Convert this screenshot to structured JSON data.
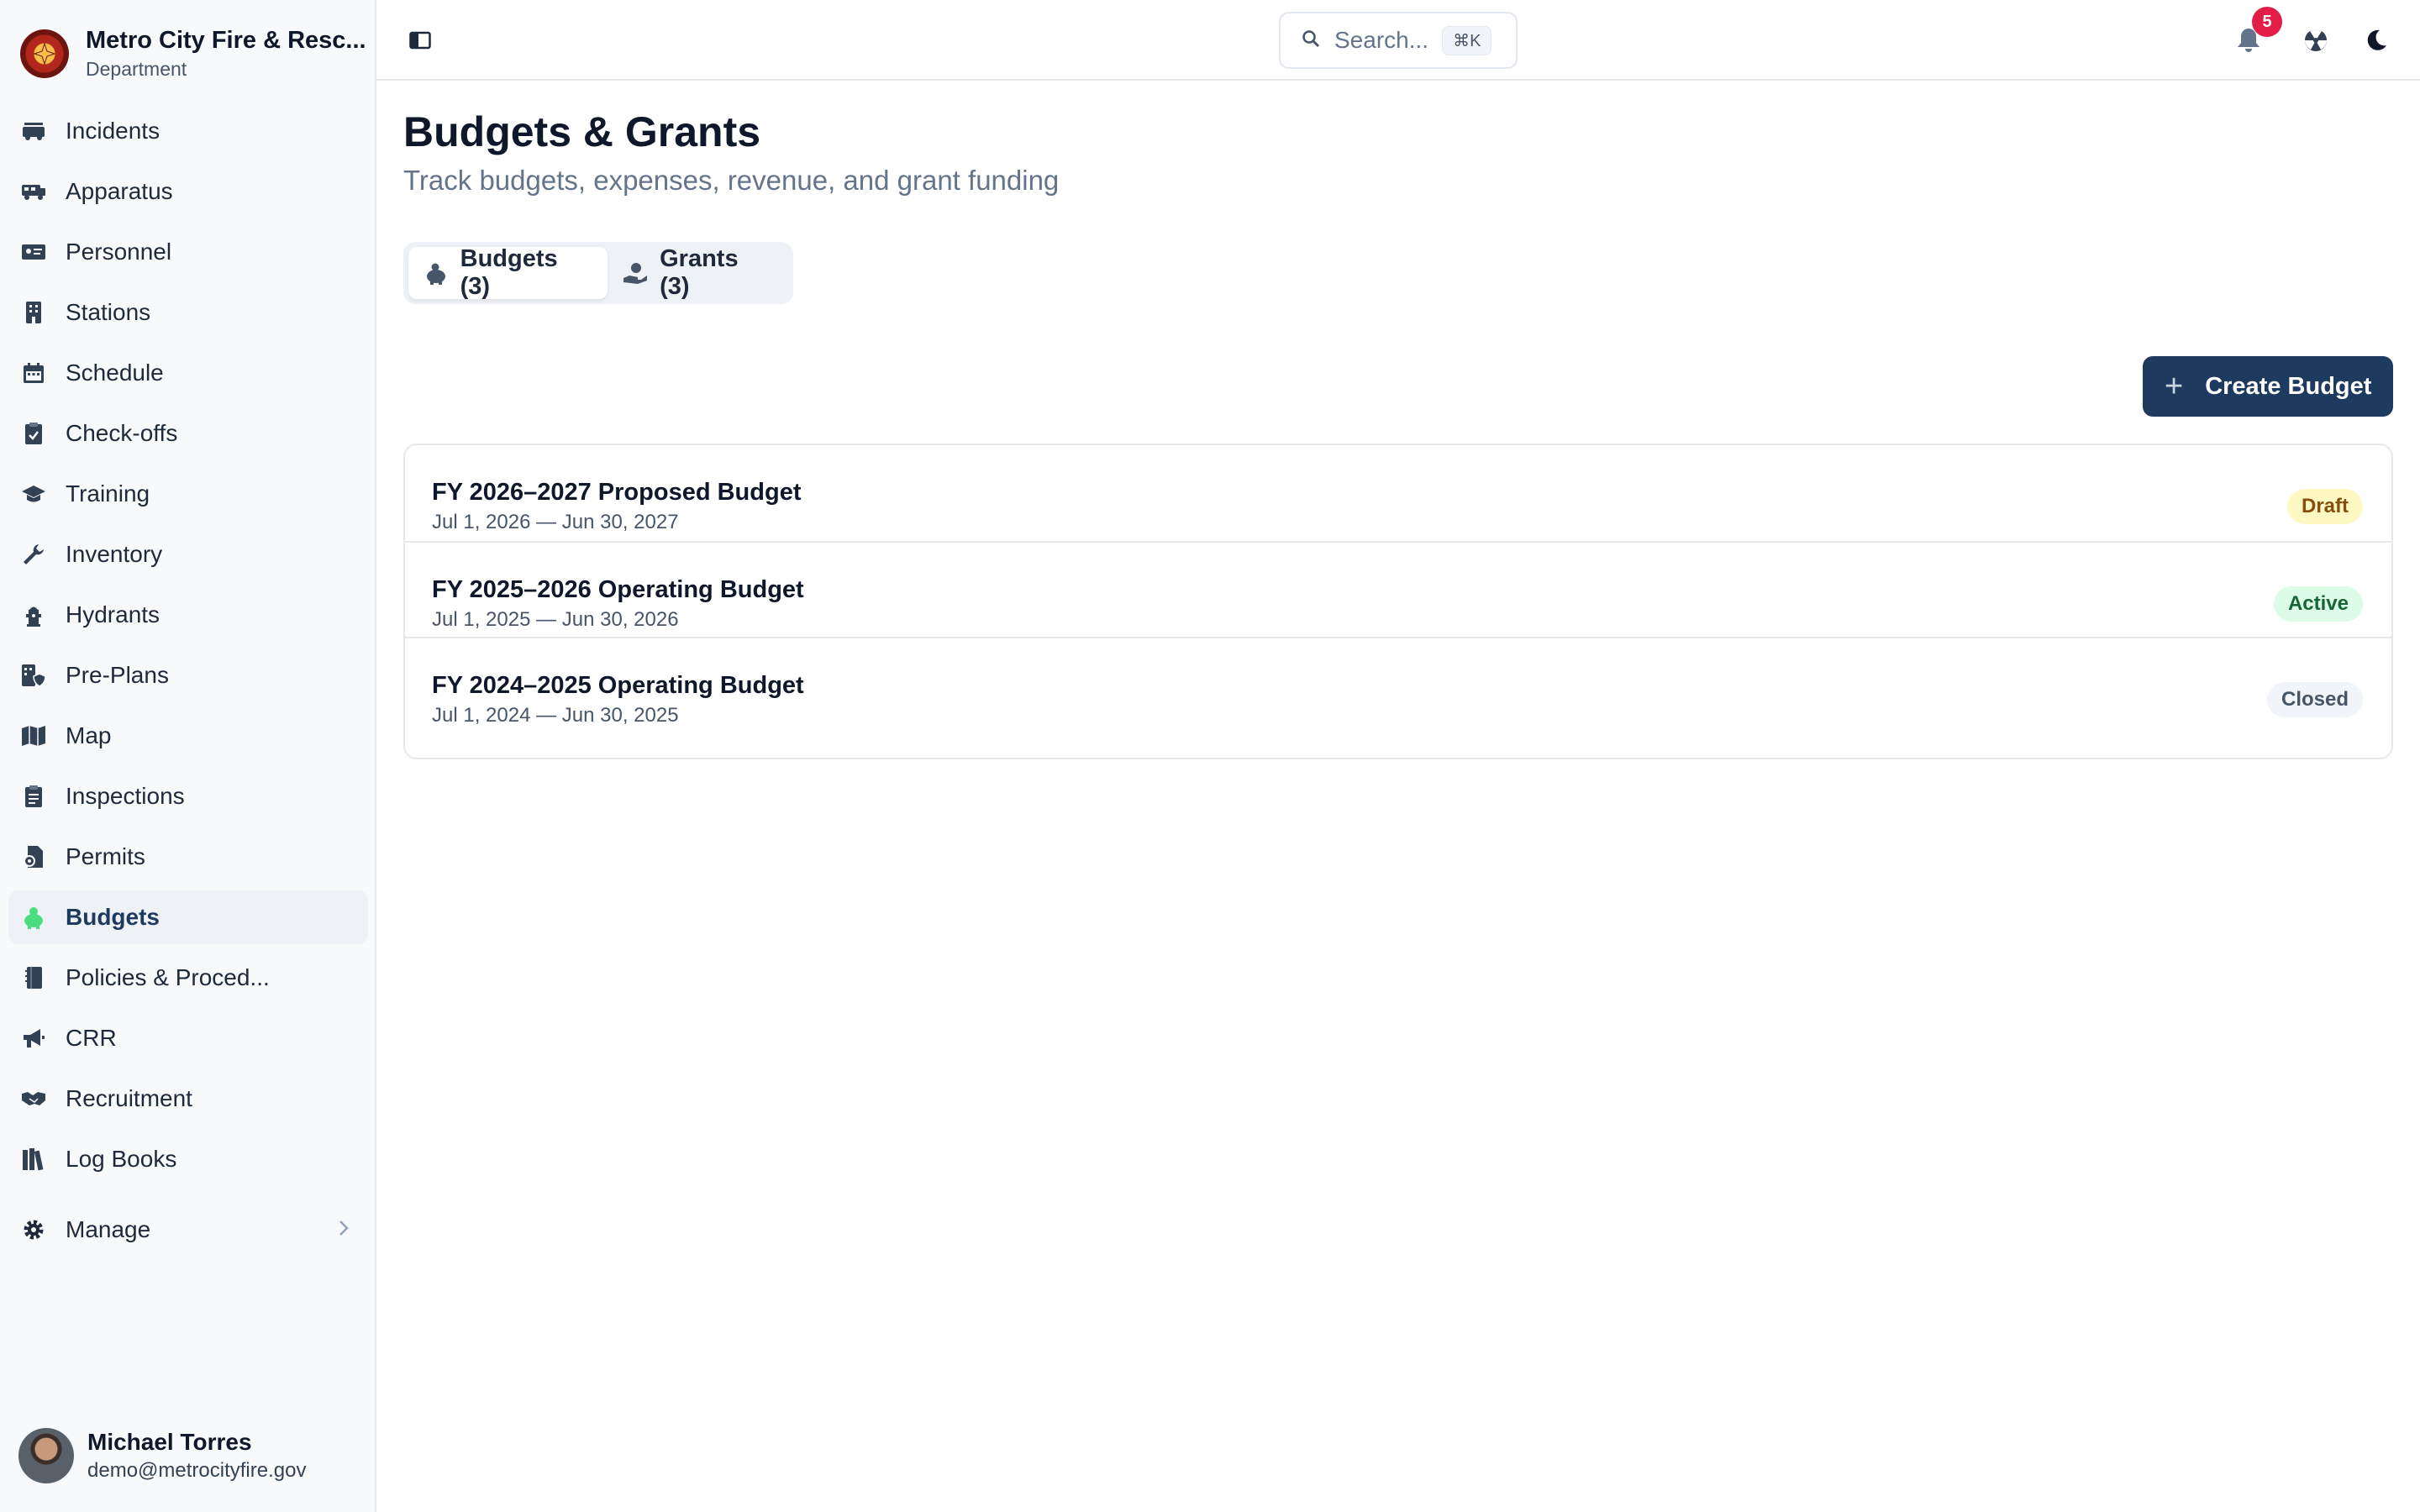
{
  "org": {
    "name": "Metro City Fire & Resc...",
    "subtitle": "Department"
  },
  "sidebar": {
    "items": [
      {
        "label": "Incidents",
        "icon": "fire-truck-icon"
      },
      {
        "label": "Apparatus",
        "icon": "truck-icon"
      },
      {
        "label": "Personnel",
        "icon": "id-card-icon"
      },
      {
        "label": "Stations",
        "icon": "building-icon"
      },
      {
        "label": "Schedule",
        "icon": "calendar-icon"
      },
      {
        "label": "Check-offs",
        "icon": "clipboard-check-icon"
      },
      {
        "label": "Training",
        "icon": "graduation-cap-icon"
      },
      {
        "label": "Inventory",
        "icon": "wrench-icon"
      },
      {
        "label": "Hydrants",
        "icon": "hydrant-icon"
      },
      {
        "label": "Pre-Plans",
        "icon": "building-shield-icon"
      },
      {
        "label": "Map",
        "icon": "map-icon"
      },
      {
        "label": "Inspections",
        "icon": "clipboard-list-icon"
      },
      {
        "label": "Permits",
        "icon": "file-certificate-icon"
      },
      {
        "label": "Budgets",
        "icon": "piggy-bank-icon",
        "active": true
      },
      {
        "label": "Policies & Proced...",
        "icon": "book-icon"
      },
      {
        "label": "CRR",
        "icon": "megaphone-icon"
      },
      {
        "label": "Recruitment",
        "icon": "handshake-icon"
      },
      {
        "label": "Log Books",
        "icon": "books-icon"
      }
    ],
    "manage": {
      "label": "Manage",
      "icon": "gear-icon"
    }
  },
  "user": {
    "name": "Michael Torres",
    "email": "demo@metrocityfire.gov"
  },
  "header": {
    "search_placeholder": "Search...",
    "search_shortcut": "⌘K",
    "notification_count": "5"
  },
  "page": {
    "title": "Budgets & Grants",
    "subtitle": "Track budgets, expenses, revenue, and grant funding"
  },
  "tabs": [
    {
      "label": "Budgets (3)",
      "icon": "piggy-bank-icon",
      "active": true
    },
    {
      "label": "Grants (3)",
      "icon": "hand-coin-icon",
      "active": false
    }
  ],
  "actions": {
    "create_label": "Create Budget"
  },
  "budgets": [
    {
      "name": "FY 2026–2027 Proposed Budget",
      "dates": "Jul 1, 2026 — Jun 30, 2027",
      "status": "Draft"
    },
    {
      "name": "FY 2025–2026 Operating Budget",
      "dates": "Jul 1, 2025 — Jun 30, 2026",
      "status": "Active"
    },
    {
      "name": "FY 2024–2025 Operating Budget",
      "dates": "Jul 1, 2024 — Jun 30, 2025",
      "status": "Closed"
    }
  ],
  "status_colors": {
    "Draft": {
      "bg": "#fef9c3",
      "fg": "#854d0e"
    },
    "Active": {
      "bg": "#dcfce7",
      "fg": "#166534"
    },
    "Closed": {
      "bg": "#f1f5f9",
      "fg": "#475569"
    }
  },
  "colors": {
    "accent": "#1e3a5f",
    "badge": "#e11d48",
    "active_icon": "#4ade80"
  }
}
